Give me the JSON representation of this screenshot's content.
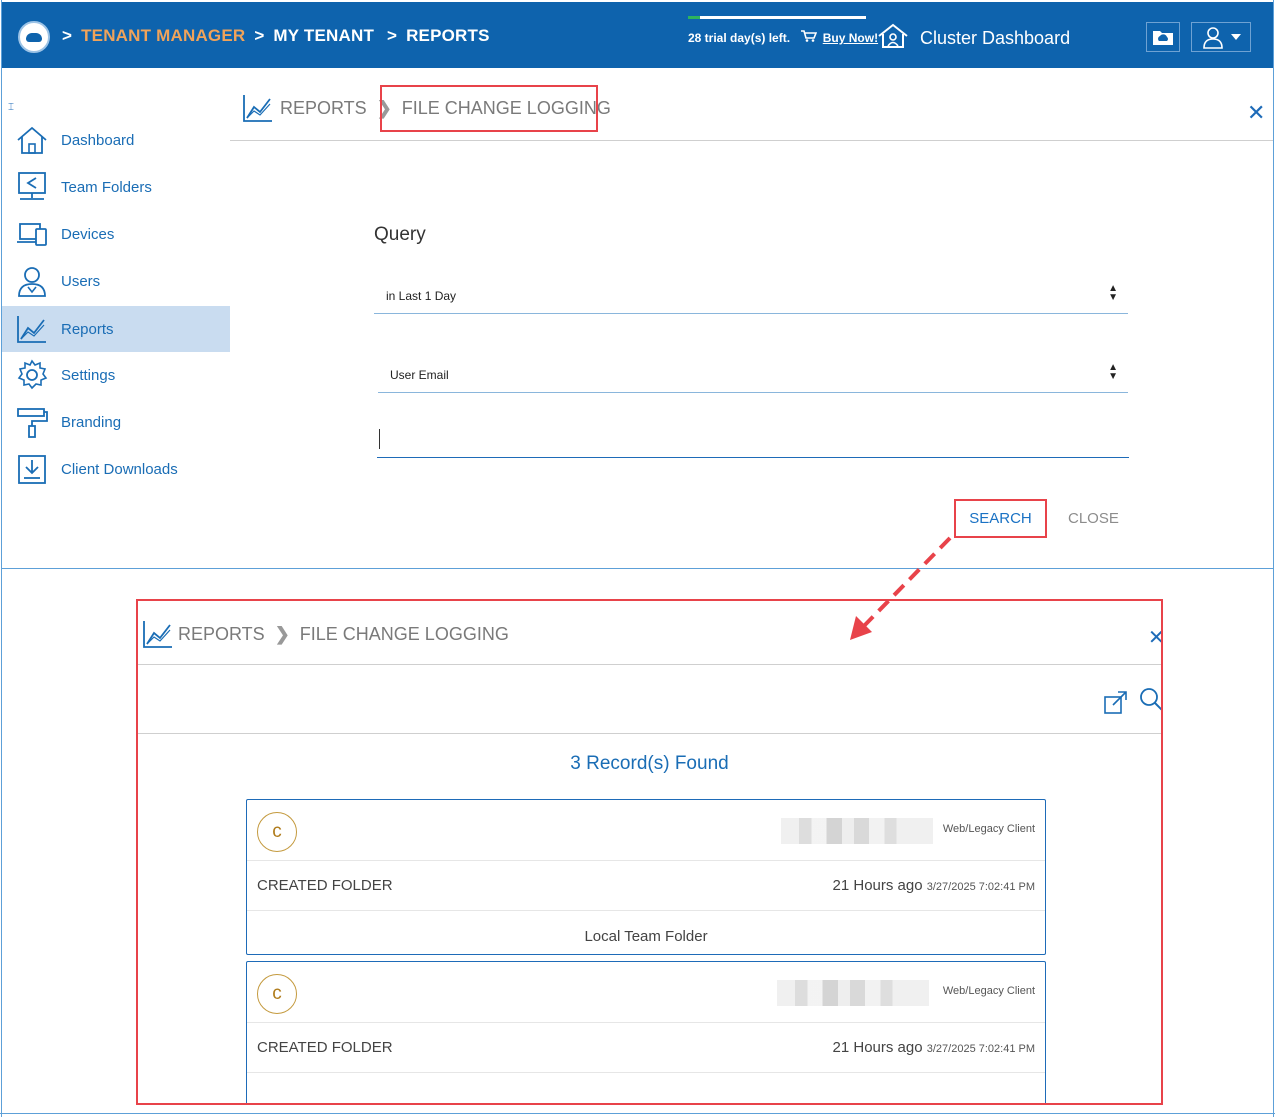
{
  "topbar": {
    "breadcrumb": [
      {
        "sep": ">",
        "label": "TENANT MANAGER",
        "color": "#f0a35a"
      },
      {
        "sep": ">",
        "label": "MY TENANT",
        "color": "#ffffff"
      },
      {
        "sep": ">",
        "label": "REPORTS",
        "color": "#ffffff"
      }
    ],
    "trial_text": "28 trial day(s) left.",
    "buy_now": "Buy Now!",
    "trial_progress": 0.07,
    "cluster_dashboard": "Cluster Dashboard"
  },
  "sidebar": {
    "items": [
      {
        "label": "Dashboard",
        "icon": "home-icon",
        "active": false
      },
      {
        "label": "Team Folders",
        "icon": "team-folder-icon",
        "active": false
      },
      {
        "label": "Devices",
        "icon": "devices-icon",
        "active": false
      },
      {
        "label": "Users",
        "icon": "users-icon",
        "active": false
      },
      {
        "label": "Reports",
        "icon": "reports-icon",
        "active": true
      },
      {
        "label": "Settings",
        "icon": "gear-icon",
        "active": false
      },
      {
        "label": "Branding",
        "icon": "paint-roller-icon",
        "active": false
      },
      {
        "label": "Client Downloads",
        "icon": "download-icon",
        "active": false
      }
    ]
  },
  "query_panel": {
    "breadcrumb_root": "REPORTS",
    "breadcrumb_current": "FILE CHANGE LOGGING",
    "title": "Query",
    "period_select": "in Last 1 Day",
    "field_select": "User Email",
    "search_value": "",
    "search_button": "SEARCH",
    "close_button": "CLOSE"
  },
  "result_panel": {
    "breadcrumb_root": "REPORTS",
    "breadcrumb_current": "FILE CHANGE LOGGING",
    "found_text": "3 Record(s) Found",
    "records": [
      {
        "avatar": "c",
        "client": "Web/Legacy Client",
        "action": "CREATED FOLDER",
        "ago": "21 Hours ago",
        "timestamp": "3/27/2025 7:02:41 PM",
        "folder": "Local Team Folder"
      },
      {
        "avatar": "c",
        "client": "Web/Legacy Client",
        "action": "CREATED FOLDER",
        "ago": "21 Hours ago",
        "timestamp": "3/27/2025 7:02:41 PM",
        "folder": ""
      }
    ]
  },
  "colors": {
    "topbar": "#0e63ad",
    "accent": "#1a6db5",
    "highlight": "#e8434a",
    "active_nav": "#c9dcf0"
  }
}
